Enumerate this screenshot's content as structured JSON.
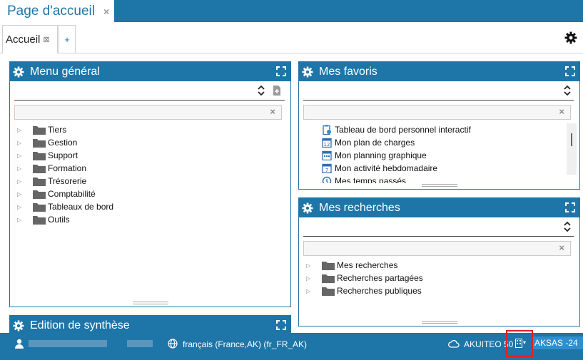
{
  "window": {
    "title": "Page d'accueil",
    "close_glyph": "×"
  },
  "tabs": [
    {
      "label": "Accueil",
      "close_glyph": "⊠"
    }
  ],
  "tab_add_glyph": "+",
  "panels": {
    "menu": {
      "title": "Menu général",
      "clear_glyph": "×",
      "items": [
        {
          "label": "Tiers"
        },
        {
          "label": "Gestion"
        },
        {
          "label": "Support"
        },
        {
          "label": "Formation"
        },
        {
          "label": "Trésorerie"
        },
        {
          "label": "Comptabilité"
        },
        {
          "label": "Tableaux de bord"
        },
        {
          "label": "Outils"
        }
      ]
    },
    "favorites": {
      "title": "Mes favoris",
      "clear_glyph": "×",
      "items": [
        {
          "label": "Tableau de bord personnel interactif",
          "icon": "clipboard-check-icon"
        },
        {
          "label": "Mon plan de charges",
          "icon": "calendar-12-icon"
        },
        {
          "label": "Mon planning graphique",
          "icon": "calendar-grid-icon"
        },
        {
          "label": "Mon activité hebdomadaire",
          "icon": "calendar-7-icon"
        },
        {
          "label": "Mes temps passés",
          "icon": "clock-icon"
        }
      ]
    },
    "searches": {
      "title": "Mes recherches",
      "clear_glyph": "×",
      "items": [
        {
          "label": "Mes recherches"
        },
        {
          "label": "Recherches partagées"
        },
        {
          "label": "Recherches publiques"
        }
      ]
    },
    "synthesis": {
      "title": "Edition de synthèse"
    }
  },
  "status": {
    "language": "français (France,AK) (fr_FR_AK)",
    "company": "AKUITEO 50",
    "environment": "AKSAS -24",
    "caret_glyph": "▾"
  },
  "colors": {
    "accent": "#1e75a8",
    "env_badge": "#2e8fd0",
    "highlight_box": "#e02020"
  }
}
